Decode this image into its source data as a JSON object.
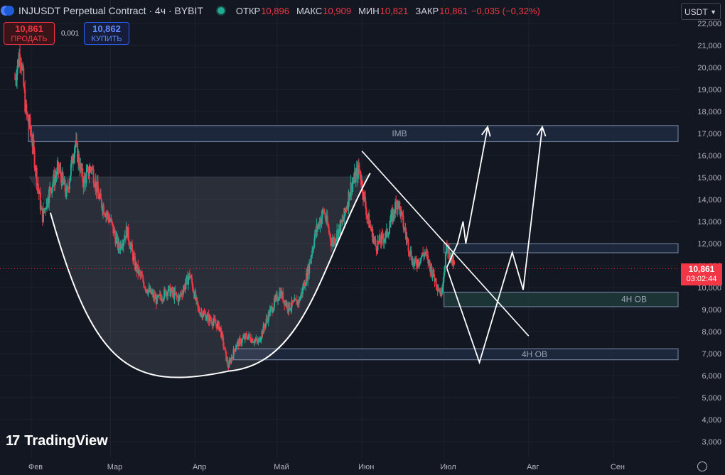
{
  "header": {
    "title": "INJUSDT Perpetual Contract · 4ч · BYBIT",
    "ohlc": [
      {
        "k": "ОТКР",
        "v": "10,896"
      },
      {
        "k": "МАКС",
        "v": "10,909"
      },
      {
        "k": "МИН",
        "v": "10,821"
      },
      {
        "k": "ЗАКР",
        "v": "10,861"
      },
      {
        "k": "",
        "v": "−0,035 (−0,32%)"
      }
    ]
  },
  "trade": {
    "sell_price": "10,861",
    "sell_label": "ПРОДАТЬ",
    "spread": "0,001",
    "buy_price": "10,862",
    "buy_label": "КУПИТЬ"
  },
  "currency": "USDT",
  "brand": "TradingView",
  "last_price": {
    "value": "10,861",
    "countdown": "03:02:44"
  },
  "colors": {
    "up": "#22ab94",
    "down": "#f23645",
    "drawing": "#ffffff",
    "zone_fill": "#2a3344",
    "zone_border": "#6b7a95"
  },
  "chart_data": {
    "type": "candlestick",
    "x_months": [
      "Фев",
      "Мар",
      "Апр",
      "Май",
      "Июн",
      "Июл",
      "Авг",
      "Сен"
    ],
    "y_ticks": [
      "22,000",
      "21,000",
      "20,000",
      "19,000",
      "18,000",
      "17,000",
      "16,000",
      "15,000",
      "14,000",
      "13,000",
      "12,000",
      "11,000",
      "10,000",
      "9,000",
      "8,000",
      "7,000",
      "6,000",
      "5,000",
      "4,000",
      "3,000"
    ],
    "ylim": [
      2.5,
      22.3
    ],
    "last_price": 10.861,
    "price_path": [
      [
        "2024-01-26",
        19.5
      ],
      [
        "2024-01-28",
        20.8
      ],
      [
        "2024-01-30",
        18.0
      ],
      [
        "2024-02-01",
        17.0
      ],
      [
        "2024-02-03",
        15.0
      ],
      [
        "2024-02-05",
        13.2
      ],
      [
        "2024-02-08",
        14.5
      ],
      [
        "2024-02-11",
        15.4
      ],
      [
        "2024-02-14",
        14.2
      ],
      [
        "2024-02-17",
        16.6
      ],
      [
        "2024-02-20",
        14.8
      ],
      [
        "2024-02-23",
        15.5
      ],
      [
        "2024-02-26",
        14.0
      ],
      [
        "2024-03-01",
        13.0
      ],
      [
        "2024-03-04",
        11.8
      ],
      [
        "2024-03-07",
        12.6
      ],
      [
        "2024-03-10",
        11.0
      ],
      [
        "2024-03-14",
        10.0
      ],
      [
        "2024-03-18",
        9.4
      ],
      [
        "2024-03-22",
        9.9
      ],
      [
        "2024-03-26",
        9.5
      ],
      [
        "2024-03-30",
        10.6
      ],
      [
        "2024-04-02",
        9.0
      ],
      [
        "2024-04-06",
        8.6
      ],
      [
        "2024-04-10",
        8.2
      ],
      [
        "2024-04-13",
        6.4
      ],
      [
        "2024-04-16",
        7.4
      ],
      [
        "2024-04-20",
        7.8
      ],
      [
        "2024-04-24",
        7.5
      ],
      [
        "2024-04-28",
        8.8
      ],
      [
        "2024-05-02",
        9.8
      ],
      [
        "2024-05-05",
        9.1
      ],
      [
        "2024-05-09",
        9.4
      ],
      [
        "2024-05-12",
        10.6
      ],
      [
        "2024-05-15",
        12.5
      ],
      [
        "2024-05-18",
        13.5
      ],
      [
        "2024-05-21",
        12.0
      ],
      [
        "2024-05-25",
        13.0
      ],
      [
        "2024-05-28",
        14.6
      ],
      [
        "2024-05-31",
        15.4
      ],
      [
        "2024-06-03",
        13.2
      ],
      [
        "2024-06-06",
        11.9
      ],
      [
        "2024-06-10",
        12.4
      ],
      [
        "2024-06-14",
        14.0
      ],
      [
        "2024-06-17",
        12.4
      ],
      [
        "2024-06-20",
        11.0
      ],
      [
        "2024-06-24",
        11.6
      ],
      [
        "2024-06-27",
        10.6
      ],
      [
        "2024-06-30",
        9.7
      ],
      [
        "2024-07-02",
        11.9
      ],
      [
        "2024-07-05",
        10.861
      ]
    ],
    "zones": [
      {
        "label": "IMB",
        "y_top": 17.36,
        "y_bottom": 16.63,
        "x_start": "2024-01-31"
      },
      {
        "label": "",
        "y_top": 11.99,
        "y_bottom": 11.58,
        "x_start": "2024-07-01"
      },
      {
        "label": "4H OB",
        "y_top": 9.79,
        "y_bottom": 9.13,
        "x_start": "2024-07-01"
      },
      {
        "label": "4H OB",
        "y_top": 7.22,
        "y_bottom": 6.72,
        "x_start": "2024-04-15"
      }
    ],
    "drawings": {
      "rounded_bottom": {
        "left": [
          "2024-02-08",
          13.4
        ],
        "bottom": [
          "2024-04-13",
          6.2
        ],
        "right": [
          "2024-06-04",
          15.2
        ]
      },
      "downtrend_line": [
        [
          "2024-06-01",
          16.2
        ],
        [
          "2024-08-01",
          7.8
        ]
      ],
      "projection_up": [
        [
          "2024-07-02",
          10.9
        ],
        [
          "2024-07-06",
          12.0
        ],
        [
          "2024-07-08",
          13.0
        ],
        [
          "2024-07-09",
          12.0
        ],
        [
          "2024-07-17",
          17.3
        ]
      ],
      "projection_down": [
        [
          "2024-07-02",
          10.9
        ],
        [
          "2024-07-14",
          6.6
        ],
        [
          "2024-07-26",
          11.6
        ],
        [
          "2024-07-30",
          9.9
        ],
        [
          "2024-08-06",
          17.3
        ]
      ]
    }
  }
}
